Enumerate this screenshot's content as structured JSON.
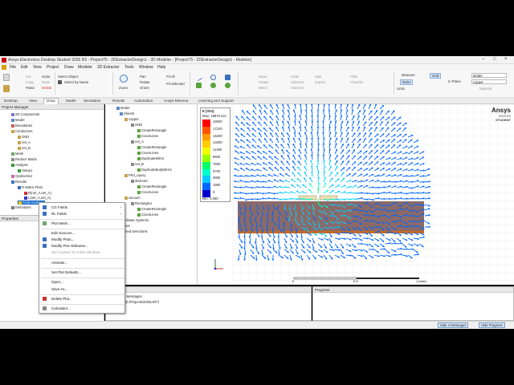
{
  "window": {
    "title": "Ansys Electronics Desktop Student 2025 R2 - Project75 - 2DExtractorDesign1 - 3D Modeler - [Project75 - 2DExtractorDesign1 - Modeler]"
  },
  "menubar": [
    "File",
    "Edit",
    "View",
    "Project",
    "Draw",
    "Modeler",
    "2D Extractor",
    "Tools",
    "Window",
    "Help"
  ],
  "ribbon": {
    "clipboard": [
      "Cut",
      "Copy",
      "Paste",
      "Undo",
      "Redo",
      "Delete"
    ],
    "select_object": "Select Object",
    "select_by_name": "Select by Name",
    "zoom": "Zoom",
    "pan": "Pan",
    "rotate": "Rotate",
    "orient": "Orient",
    "fit_all": "Fit All",
    "fit_selected": "Fit Selected",
    "edit_ops": [
      "Move",
      "Rotate",
      "Mirror",
      "Unite",
      "Subtract",
      "Intersect",
      "Split",
      "Imprint",
      "Fillet",
      "Chamfer"
    ],
    "measure": "Measure",
    "ruler": "Ruler",
    "units": "Units",
    "grid": "Grid",
    "in_plane": "In Plane",
    "model_value": "Model",
    "material_value": "copper",
    "material_btn": "Material"
  },
  "tabs": [
    "Desktop",
    "View",
    "Draw",
    "Model",
    "Simulation",
    "Results",
    "Automation",
    "Ansys Minerva",
    "Learning and Support"
  ],
  "active_tab": "Draw",
  "project_manager": {
    "header": "Project Manager",
    "items": [
      "2D Components",
      "Model",
      "Boundaries",
      "Conductors",
      "GND",
      "net_A",
      "net_B",
      "Mesh",
      "Reduce Matrix",
      "Analysis",
      "Setup1",
      "Optimetrics",
      "Results",
      "R Matrix Plot1",
      "R(net_A,net_A)",
      "L(net_A,net_A)",
      "Field Overlays",
      "Definitions"
    ]
  },
  "properties_header": "Properties",
  "model_tree": {
    "items": [
      "Model",
      "Sheets",
      "copper",
      "GND",
      "CreateRectangle",
      "CoverLines",
      "net_A",
      "CreateRectangle",
      "CoverLines",
      "DuplicateMirror",
      "net_B",
      "DuplicateBodyMirror",
      "FR4_epoxy",
      "dielectric",
      "CreateRectangle",
      "CoverLines",
      "vacuum",
      "Rectangle1",
      "CreateRectangle",
      "CoverLines",
      "rdinate Systems",
      "nes",
      "med Selections"
    ]
  },
  "legend": {
    "title": "E [V/m]",
    "max": "Max: 18870.221",
    "min_label": "Min:",
    "min_value": "0.000",
    "values": [
      "19000",
      "17100",
      "15200",
      "13300",
      "11400",
      "9500",
      "7600",
      "5700",
      "3800",
      "1900",
      "0"
    ],
    "colors": [
      "#ff0000",
      "#ff5500",
      "#ff9900",
      "#ffcc00",
      "#eeff00",
      "#99ff00",
      "#00ff66",
      "#00ffcc",
      "#00ccff",
      "#0066ff",
      "#0000cc"
    ]
  },
  "logo": {
    "brand": "Ansys",
    "version": "2025 R2",
    "edition": "STUDENT"
  },
  "scale": {
    "ticks": [
      "0",
      "0.5",
      "1 (mm)"
    ]
  },
  "messages": {
    "header": "Manager",
    "line1": "obal - Messages",
    "line2": "ct75 (D:/Projects/2025LRF/)"
  },
  "progress_header": "Progress",
  "status": {
    "hide_messages": "Hide 4 Messages",
    "hide_progress": "Hide Progress"
  },
  "context_menu": {
    "items": [
      {
        "label": "CG Fields",
        "sub": true,
        "disabled": false
      },
      {
        "label": "RL Fields",
        "sub": true,
        "disabled": false
      },
      {
        "label": "Plot Mesh...",
        "sub": false,
        "disabled": false
      },
      {
        "label": "Edit Sources...",
        "sub": false,
        "disabled": false
      },
      {
        "label": "Modify Plots...",
        "sub": false,
        "disabled": false
      },
      {
        "label": "Modify Plot Attributes...",
        "sub": false,
        "disabled": false
      },
      {
        "label": "Set Context To Active Window...",
        "sub": false,
        "disabled": true
      },
      {
        "label": "Animate...",
        "sub": false,
        "disabled": false
      },
      {
        "label": "Set Plot Defaults...",
        "sub": false,
        "disabled": false
      },
      {
        "label": "Open...",
        "sub": false,
        "disabled": false
      },
      {
        "label": "Save As...",
        "sub": false,
        "disabled": false
      },
      {
        "label": "Delete Plot...",
        "sub": false,
        "disabled": false
      },
      {
        "label": "Calculator...",
        "sub": false,
        "disabled": false
      }
    ]
  }
}
